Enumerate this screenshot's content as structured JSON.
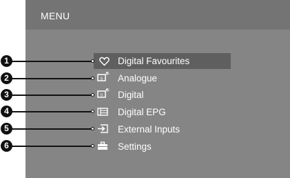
{
  "menu": {
    "title": "MENU",
    "items": [
      {
        "number": "1",
        "label": "Digital Favourites",
        "icon": "heart-icon",
        "selected": true
      },
      {
        "number": "2",
        "label": "Analogue",
        "icon": "analogue-tv-icon",
        "selected": false
      },
      {
        "number": "3",
        "label": "Digital",
        "icon": "digital-tv-icon",
        "selected": false
      },
      {
        "number": "4",
        "label": "Digital EPG",
        "icon": "epg-grid-icon",
        "selected": false
      },
      {
        "number": "5",
        "label": "External Inputs",
        "icon": "input-arrow-icon",
        "selected": false
      },
      {
        "number": "6",
        "label": "Settings",
        "icon": "toolbox-icon",
        "selected": false
      }
    ]
  },
  "colors": {
    "panel": "#858585",
    "header": "#747474",
    "highlight": "#5f5f5f",
    "text": "#ffffff",
    "callout": "#111111"
  }
}
